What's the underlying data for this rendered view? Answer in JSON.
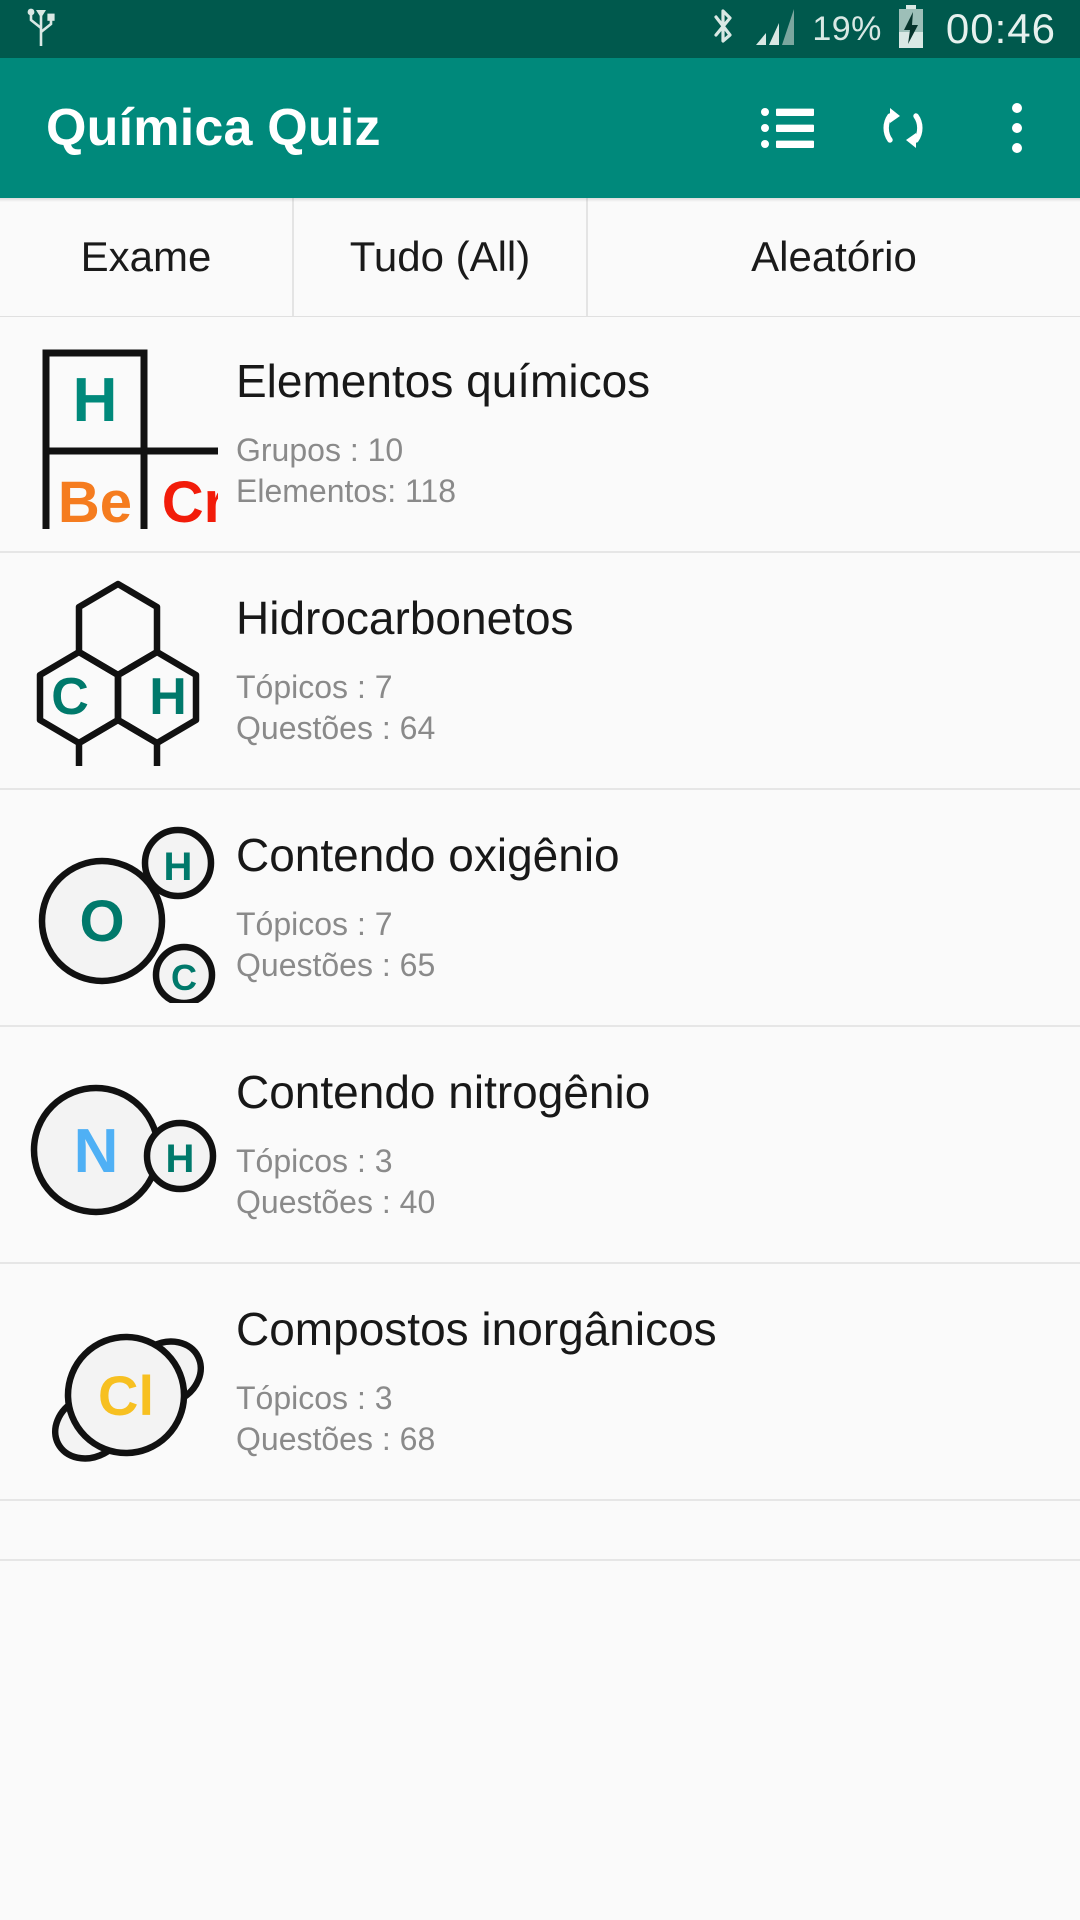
{
  "statusbar": {
    "usb_icon": "usb-icon",
    "bluetooth_icon": "bluetooth-icon",
    "signal_icon": "cellular-signal-icon",
    "battery_percent": "19%",
    "battery_icon": "battery-charging-icon",
    "clock": "00:46"
  },
  "appbar": {
    "title": "Química Quiz",
    "list_icon": "list-view-icon",
    "refresh_icon": "refresh-icon",
    "overflow_icon": "overflow-menu-icon",
    "background": "#00897b"
  },
  "tabs": [
    {
      "label": "Exame"
    },
    {
      "label": "Tudo (All)"
    },
    {
      "label": "Aleatório"
    }
  ],
  "list": [
    {
      "icon": "periodic-table-icon",
      "title": "Elementos químicos",
      "sub1": "Grupos : 10",
      "sub2": "Elementos: 118",
      "symbols": [
        "H",
        "Be",
        "Cr"
      ],
      "symbol_colors": [
        "#00897b",
        "#f57c1f",
        "#f21c0a"
      ]
    },
    {
      "icon": "hydrocarbon-rings-icon",
      "title": "Hidrocarbonetos",
      "sub1": "Tópicos : 7",
      "sub2": "Questões : 64",
      "symbols": [
        "C",
        "H"
      ],
      "symbol_colors": [
        "#00796b",
        "#00796b"
      ]
    },
    {
      "icon": "oxygen-molecule-icon",
      "title": "Contendo oxigênio",
      "sub1": "Tópicos : 7",
      "sub2": "Questões : 65",
      "symbols": [
        "O",
        "H",
        "C"
      ],
      "symbol_colors": [
        "#00796b",
        "#00796b",
        "#00796b"
      ]
    },
    {
      "icon": "nitrogen-molecule-icon",
      "title": "Contendo nitrogênio",
      "sub1": "Tópicos : 3",
      "sub2": "Questões : 40",
      "symbols": [
        "N",
        "H"
      ],
      "symbol_colors": [
        "#4fb0f5",
        "#00796b"
      ]
    },
    {
      "icon": "chlorine-molecule-icon",
      "title": "Compostos inorgânicos",
      "sub1": "Tópicos : 3",
      "sub2": "Questões : 68",
      "symbols": [
        "Cl"
      ],
      "symbol_colors": [
        "#f7c021"
      ]
    }
  ]
}
